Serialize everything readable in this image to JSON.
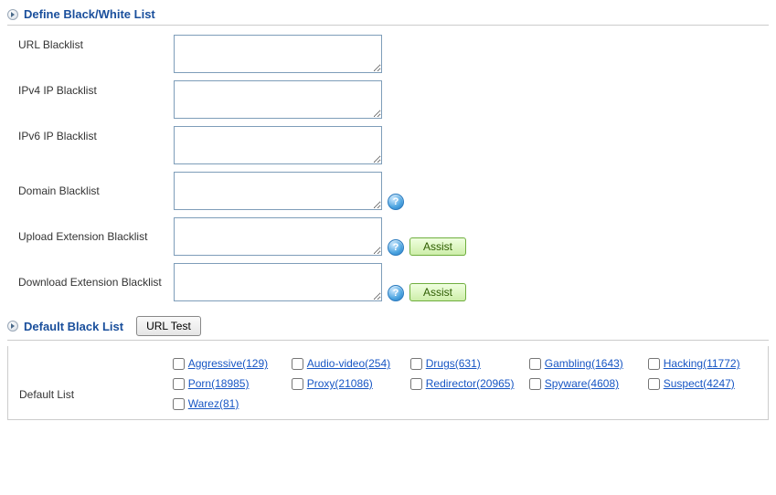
{
  "section1": {
    "title": "Define Black/White List",
    "rows": {
      "url_blacklist": {
        "label": "URL Blacklist",
        "value": "",
        "help": false,
        "assist": false
      },
      "ipv4_blacklist": {
        "label": "IPv4 IP Blacklist",
        "value": "",
        "help": false,
        "assist": false
      },
      "ipv6_blacklist": {
        "label": "IPv6 IP Blacklist",
        "value": "",
        "help": false,
        "assist": false
      },
      "domain_blacklist": {
        "label": "Domain Blacklist",
        "value": "",
        "help": true,
        "assist": false
      },
      "upload_ext_blacklist": {
        "label": "Upload Extension Blacklist",
        "value": "",
        "help": true,
        "assist": true
      },
      "download_ext_blacklist": {
        "label": "Download Extension Blacklist",
        "value": "",
        "help": true,
        "assist": true
      }
    },
    "assist_label": "Assist",
    "help_char": "?"
  },
  "section2": {
    "title": "Default Black List",
    "url_test_label": "URL Test",
    "default_list_label": "Default List",
    "categories": [
      {
        "name": "Aggressive",
        "count": 129
      },
      {
        "name": "Audio-video",
        "count": 254
      },
      {
        "name": "Drugs",
        "count": 631
      },
      {
        "name": "Gambling",
        "count": 1643
      },
      {
        "name": "Hacking",
        "count": 11772
      },
      {
        "name": "Porn",
        "count": 18985
      },
      {
        "name": "Proxy",
        "count": 21086
      },
      {
        "name": "Redirector",
        "count": 20965
      },
      {
        "name": "Spyware",
        "count": 4608
      },
      {
        "name": "Suspect",
        "count": 4247
      },
      {
        "name": "Warez",
        "count": 81
      }
    ]
  }
}
